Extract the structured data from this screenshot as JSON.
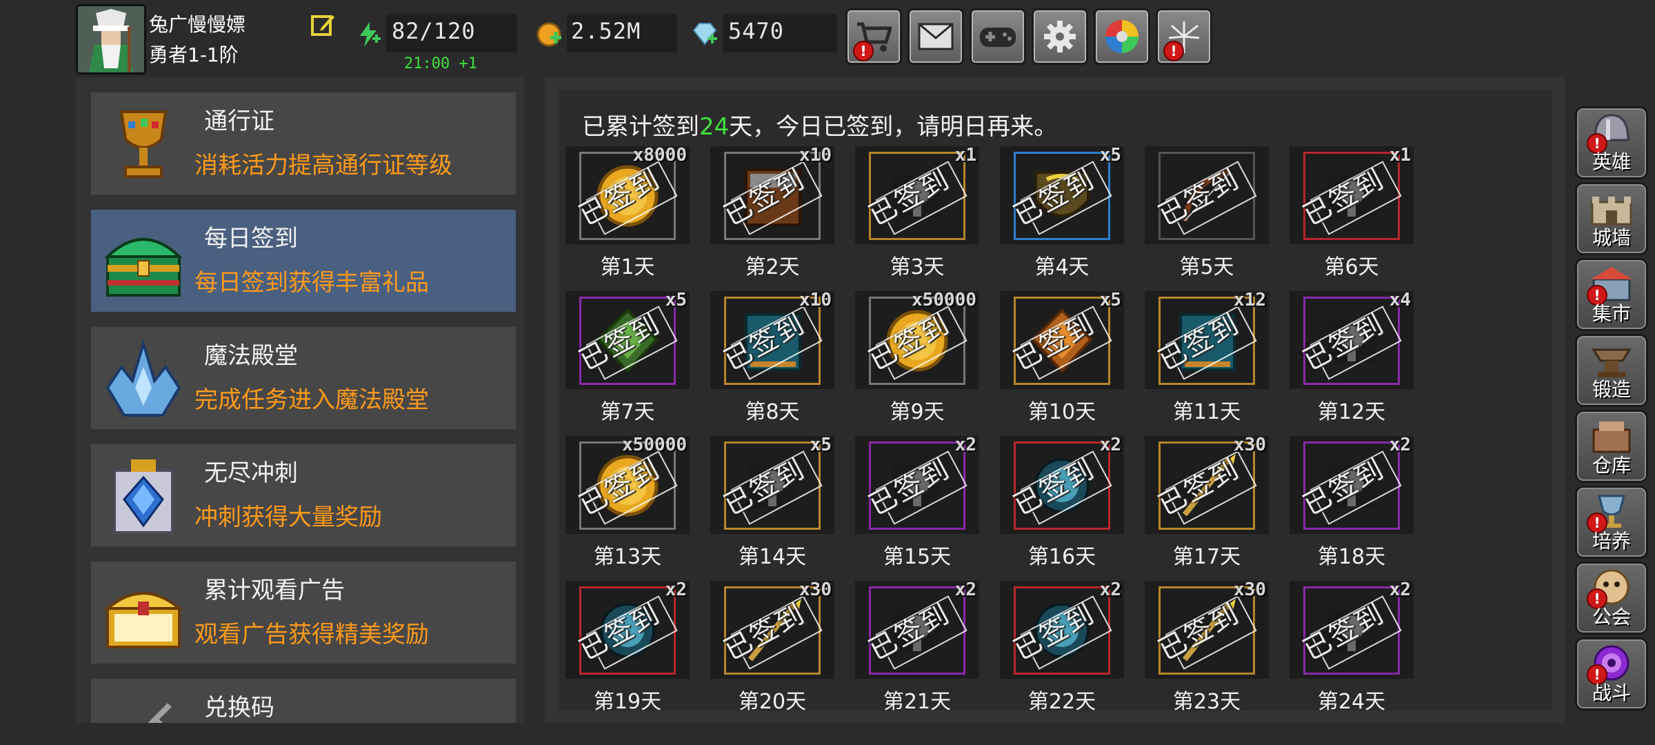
{
  "player": {
    "name": "兔广慢慢嫖",
    "rank": "勇者1-1阶"
  },
  "resources": {
    "energy": "82/120",
    "energy_timer": "21:00 +1",
    "gold": "2.52M",
    "gems": "5470"
  },
  "top_buttons": [
    {
      "name": "shop",
      "icon": "cart-icon",
      "alert": true
    },
    {
      "name": "mail",
      "icon": "mail-icon",
      "alert": false
    },
    {
      "name": "gamepad",
      "icon": "gamepad-icon",
      "alert": false
    },
    {
      "name": "settings",
      "icon": "gear-icon",
      "alert": false
    },
    {
      "name": "colors",
      "icon": "color-wheel-icon",
      "alert": false
    },
    {
      "name": "fireworks",
      "icon": "fireworks-icon",
      "alert": true
    }
  ],
  "menu": [
    {
      "title": "通行证",
      "desc": "消耗活力提高通行证等级",
      "icon": "chalice-icon",
      "active": false
    },
    {
      "title": "每日签到",
      "desc": "每日签到获得丰富礼品",
      "icon": "treasure-chest-icon",
      "active": true
    },
    {
      "title": "魔法殿堂",
      "desc": "完成任务进入魔法殿堂",
      "icon": "crystal-crown-icon",
      "active": false
    },
    {
      "title": "无尽冲刺",
      "desc": "冲刺获得大量奖励",
      "icon": "crystal-trophy-icon",
      "active": false
    },
    {
      "title": "累计观看广告",
      "desc": "观看广告获得精美奖励",
      "icon": "gold-chest-icon",
      "active": false
    },
    {
      "title": "兑换码",
      "desc": "",
      "icon": "key-icon",
      "active": false
    }
  ],
  "signin": {
    "prefix": "已累计签到",
    "days": "24",
    "suffix": "天，今日已签到，请明日再来。",
    "stamp": "已签到"
  },
  "rewards": [
    {
      "day": "第1天",
      "qty": "x8000",
      "item": "gold-coin-icon",
      "rarity": "#777777"
    },
    {
      "day": "第2天",
      "qty": "x10",
      "item": "book-icon",
      "rarity": "#777777"
    },
    {
      "day": "第3天",
      "qty": "x1",
      "item": "scroll-icon",
      "rarity": "#b8862b"
    },
    {
      "day": "第4天",
      "qty": "x5",
      "item": "shield-icon",
      "rarity": "#2e7fd0"
    },
    {
      "day": "第5天",
      "qty": "",
      "item": "bow-icon",
      "rarity": "#555555"
    },
    {
      "day": "第6天",
      "qty": "x1",
      "item": "scroll-icon",
      "rarity": "#b8262b"
    },
    {
      "day": "第7天",
      "qty": "x5",
      "item": "green-gem-icon",
      "rarity": "#8a2aa8"
    },
    {
      "day": "第8天",
      "qty": "x10",
      "item": "blue-book-icon",
      "rarity": "#b8862b"
    },
    {
      "day": "第9天",
      "qty": "x50000",
      "item": "gold-coin-icon",
      "rarity": "#777777"
    },
    {
      "day": "第10天",
      "qty": "x5",
      "item": "amber-gem-icon",
      "rarity": "#b8862b"
    },
    {
      "day": "第11天",
      "qty": "x12",
      "item": "blue-book-icon",
      "rarity": "#b8862b"
    },
    {
      "day": "第12天",
      "qty": "x4",
      "item": "scroll-icon",
      "rarity": "#8a2aa8"
    },
    {
      "day": "第13天",
      "qty": "x50000",
      "item": "gold-coin-icon",
      "rarity": "#777777"
    },
    {
      "day": "第14天",
      "qty": "x5",
      "item": "scroll-icon",
      "rarity": "#b8862b"
    },
    {
      "day": "第15天",
      "qty": "x2",
      "item": "scroll-icon",
      "rarity": "#8a2aa8"
    },
    {
      "day": "第16天",
      "qty": "x2",
      "item": "blue-orb-icon",
      "rarity": "#b8262b"
    },
    {
      "day": "第17天",
      "qty": "x30",
      "item": "wand-icon",
      "rarity": "#b8862b"
    },
    {
      "day": "第18天",
      "qty": "x2",
      "item": "scroll-icon",
      "rarity": "#8a2aa8"
    },
    {
      "day": "第19天",
      "qty": "x2",
      "item": "blue-orb-icon",
      "rarity": "#b8262b"
    },
    {
      "day": "第20天",
      "qty": "x30",
      "item": "wand-icon",
      "rarity": "#b8862b"
    },
    {
      "day": "第21天",
      "qty": "x2",
      "item": "scroll-icon",
      "rarity": "#8a2aa8"
    },
    {
      "day": "第22天",
      "qty": "x2",
      "item": "blue-orb-icon",
      "rarity": "#b8262b"
    },
    {
      "day": "第23天",
      "qty": "x30",
      "item": "wand-icon",
      "rarity": "#b8862b"
    },
    {
      "day": "第24天",
      "qty": "x2",
      "item": "scroll-icon",
      "rarity": "#8a2aa8"
    }
  ],
  "right_nav": [
    {
      "label": "英雄",
      "icon": "helmet-icon",
      "alert": true
    },
    {
      "label": "城墙",
      "icon": "castle-wall-icon",
      "alert": false
    },
    {
      "label": "集市",
      "icon": "market-icon",
      "alert": true
    },
    {
      "label": "锻造",
      "icon": "anvil-icon",
      "alert": false
    },
    {
      "label": "仓库",
      "icon": "warehouse-icon",
      "alert": false
    },
    {
      "label": "培养",
      "icon": "goblet-icon",
      "alert": true
    },
    {
      "label": "公会",
      "icon": "guild-icon",
      "alert": true
    },
    {
      "label": "战斗",
      "icon": "portal-icon",
      "alert": true
    }
  ],
  "colors": {
    "accent_orange": "#ff9a1a",
    "accent_green": "#3fe23f",
    "active_menu": "#4a6080",
    "alert_red": "#d01818"
  }
}
